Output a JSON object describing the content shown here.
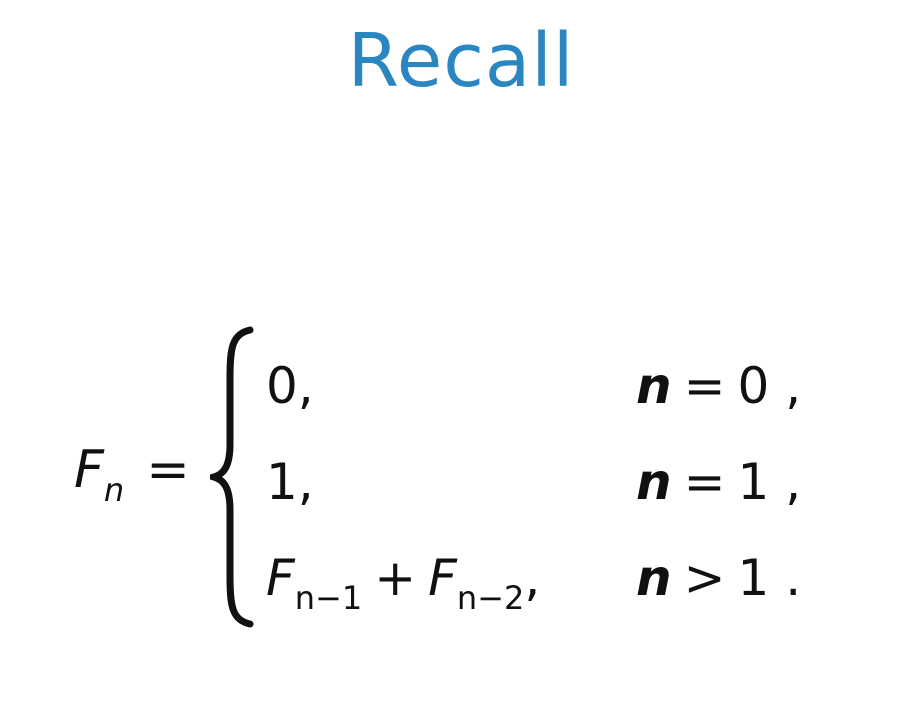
{
  "slide": {
    "title": "Recall",
    "colors": {
      "title": "#2a86c0",
      "text": "#111111",
      "background": "#ffffff"
    }
  },
  "formula": {
    "lhs_symbol": "F",
    "lhs_subscript": "n",
    "equals": "=",
    "cases": [
      {
        "value": {
          "text": "0,"
        },
        "condition": {
          "var": "n",
          "op": "=",
          "rhs": "0 ,"
        }
      },
      {
        "value": {
          "text": "1,"
        },
        "condition": {
          "var": "n",
          "op": "=",
          "rhs": "1 ,"
        }
      },
      {
        "value": {
          "term1_symbol": "F",
          "term1_subscript": "n−1",
          "plus": "+",
          "term2_symbol": "F",
          "term2_subscript": "n−2",
          "trail": ","
        },
        "condition": {
          "var": "n",
          "op": ">",
          "rhs": "1 ."
        }
      }
    ]
  }
}
